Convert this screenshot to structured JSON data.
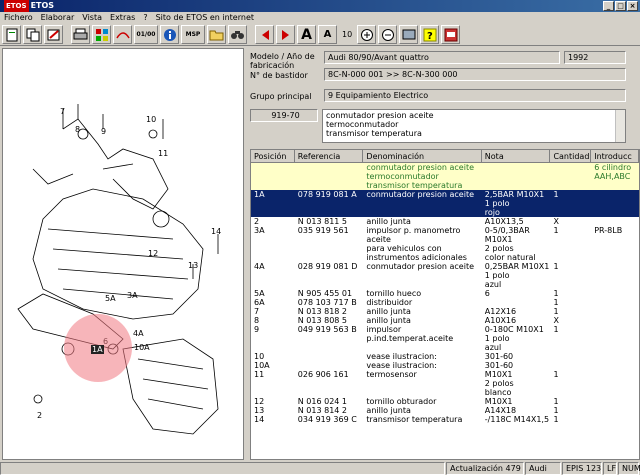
{
  "window": {
    "title": "ETOS",
    "logo": "ETOS",
    "btn_min": "_",
    "btn_max": "□",
    "btn_close": "×"
  },
  "menu": [
    "Fichero",
    "Elaborar",
    "Vista",
    "Extras",
    "?",
    "Sito de ETOS en internet"
  ],
  "toolbar": {
    "msp": "MSP",
    "font_big": "A",
    "font_small": "A",
    "font_size": "10",
    "btn_01": "01/00"
  },
  "header": {
    "model_label": "Modelo / Año de fabricación",
    "model_value": "Audi 80/90/Avant quattro",
    "year_value": "1992",
    "chassis_label": "N° de bastidor",
    "chassis_value": "8C-N-000 001 >> 8C-N-300 000",
    "group_label": "Grupo principal",
    "group_value": "9   Equipamiento Electrico",
    "part_code": "919-70",
    "part_desc": [
      "conmutador presion aceite",
      "termoconmutador",
      "transmisor temperatura"
    ]
  },
  "table": {
    "columns": [
      "Posición",
      "Referencia",
      "Denominación",
      "Nota",
      "Cantidad",
      "Introducc"
    ],
    "rows": [
      {
        "pos": "",
        "ref": "",
        "den": "conmutador presion aceite\ntermoconmutador\ntransmisor temperatura",
        "nota": "",
        "cant": "",
        "intro": "6 cilindro\nAAH,ABC",
        "style": "hl0"
      },
      {
        "pos": "1A",
        "ref": "078 919 081 A",
        "den": "conmutador presion aceite",
        "nota": "2,5BAR  M10X1\n1 polo\nrojo",
        "cant": "1",
        "intro": "",
        "style": "sel"
      },
      {
        "pos": "2",
        "ref": "N  013 811 5",
        "den": "anillo junta",
        "nota": "A10X13,5",
        "cant": "X",
        "intro": "",
        "style": ""
      },
      {
        "pos": "3A",
        "ref": "035 919 561",
        "den": "impulsor p. manometro aceite\npara vehiculos con\ninstrumentos adicionales",
        "nota": "0-5/0,3BAR\n           M10X1\n2 polos\ncolor natural",
        "cant": "1",
        "intro": "PR-8LB",
        "style": ""
      },
      {
        "pos": "4A",
        "ref": "028 919 081 D",
        "den": "conmutador presion aceite",
        "nota": "0,25BAR  M10X1\n1 polo\nazul",
        "cant": "1",
        "intro": "",
        "style": ""
      },
      {
        "pos": "5A",
        "ref": "N  905 455 01",
        "den": "tornillo hueco",
        "nota": "6",
        "cant": "1",
        "intro": "",
        "style": ""
      },
      {
        "pos": "6A",
        "ref": "078 103 717 B",
        "den": "distribuidor",
        "nota": "",
        "cant": "1",
        "intro": "",
        "style": ""
      },
      {
        "pos": "7",
        "ref": "N  013 818 2",
        "den": "anillo junta",
        "nota": "A12X16",
        "cant": "1",
        "intro": "",
        "style": ""
      },
      {
        "pos": "8",
        "ref": "N  013 808 5",
        "den": "anillo junta",
        "nota": "A10X16",
        "cant": "X",
        "intro": "",
        "style": ""
      },
      {
        "pos": "9",
        "ref": "049 919 563 B",
        "den": "impulsor p.ind.temperat.aceite",
        "nota": "0-180C  M10X1\n1 polo\nazul",
        "cant": "1",
        "intro": "",
        "style": ""
      },
      {
        "pos": "10",
        "ref": "",
        "den": "               vease ilustracion:",
        "nota": "301-60",
        "cant": "",
        "intro": "",
        "style": ""
      },
      {
        "pos": "10A",
        "ref": "",
        "den": "               vease ilustracion:",
        "nota": "301-60",
        "cant": "",
        "intro": "",
        "style": ""
      },
      {
        "pos": "11",
        "ref": "026 906 161",
        "den": "termosensor",
        "nota": "           M10X1\n2 polos\nblanco",
        "cant": "1",
        "intro": "",
        "style": ""
      },
      {
        "pos": "12",
        "ref": "N  016 024 1",
        "den": "tornillo obturador",
        "nota": "M10X1",
        "cant": "1",
        "intro": "",
        "style": ""
      },
      {
        "pos": "13",
        "ref": "N  013 814 2",
        "den": "anillo junta",
        "nota": "A14X18",
        "cant": "1",
        "intro": "",
        "style": ""
      },
      {
        "pos": "14",
        "ref": "034 919 369 C",
        "den": "transmisor temperatura",
        "nota": "-/118C M14X1,5",
        "cant": "1",
        "intro": "",
        "style": ""
      }
    ]
  },
  "diagram": {
    "labels": [
      "7",
      "8",
      "9",
      "10",
      "11",
      "12",
      "13",
      "14",
      "3A",
      "4A",
      "5A",
      "6",
      "1A",
      "2",
      "10A"
    ]
  },
  "status": {
    "update": "Actualización 479",
    "brand": "Audi",
    "epis": "EPIS 123",
    "lf": "LF",
    "num": "NUM"
  }
}
